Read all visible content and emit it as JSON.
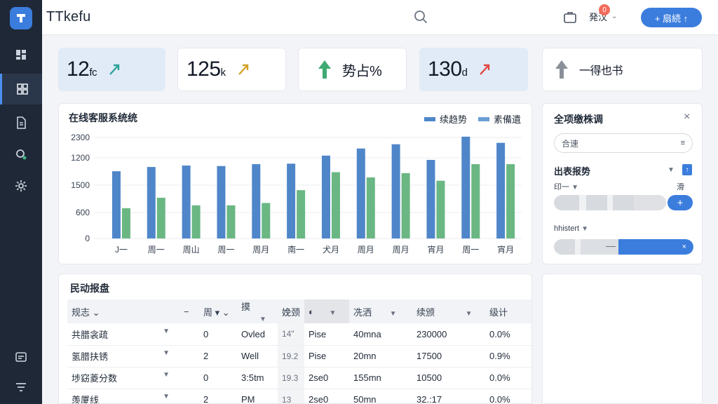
{
  "app": {
    "title": "TTkefu"
  },
  "header": {
    "user_label": "発汉",
    "badge": "0",
    "action_label": "+ 扇続 ↑"
  },
  "sidebar": {
    "items": [
      "dashboard",
      "grid",
      "docs",
      "search",
      "settings"
    ],
    "bottom": [
      "chat",
      "filter"
    ]
  },
  "stats": [
    {
      "value": "12",
      "suffix": "fc",
      "trend": "up"
    },
    {
      "value": "125",
      "suffix": "k",
      "trend": "up"
    },
    {
      "value": "",
      "label": "势占%",
      "trend": "up"
    },
    {
      "value": "130",
      "suffix": "d",
      "trend": "up"
    },
    {
      "value": "",
      "label": "一得也书",
      "trend": "up"
    }
  ],
  "chart_panel": {
    "title": "在线客服系统统",
    "legend": [
      "续趋势",
      "素備遺"
    ]
  },
  "chart_data": {
    "type": "bar",
    "categories": [
      "J一",
      "周一",
      "周山",
      "周一",
      "周月",
      "南一",
      "犬月",
      "周月",
      "周月",
      "宵月",
      "周一",
      "宵月"
    ],
    "yticks": [
      "2300",
      "1200",
      "1500",
      "600",
      "0"
    ],
    "series": [
      {
        "name": "续趋势",
        "color": "#4f86c9",
        "values": [
          1420,
          1510,
          1540,
          1530,
          1570,
          1580,
          1750,
          1900,
          1990,
          1660,
          2150,
          2020
        ]
      },
      {
        "name": "素備遺",
        "color": "#6ab784",
        "values": [
          640,
          860,
          700,
          700,
          750,
          1020,
          1400,
          1290,
          1380,
          1220,
          1570,
          1570
        ]
      }
    ],
    "ylim": [
      0,
      2400
    ]
  },
  "right_panel": {
    "title": "全项缴株调",
    "close": "×",
    "input_value": "合速",
    "section1_label": "出表报势",
    "section1_sub": "印一",
    "section1_sub_right": "滑",
    "section2_label": "hhistert",
    "plus": "+",
    "x": "×"
  },
  "table": {
    "title": "民动报盘",
    "headers": [
      "规志 ⌄",
      "",
      "周 ▾ ⌄",
      "摸",
      "",
      "娩颈",
      "",
      "冼洒",
      "",
      "续颁",
      "",
      "级计"
    ],
    "rows": [
      [
        "共腊衾疏",
        "0",
        "Ovled",
        "14\"",
        "Pise",
        "40mna",
        "230000",
        "0.0%"
      ],
      [
        "氢腊扶锈",
        "2",
        "Well",
        "19.2",
        "Pise",
        "20mn",
        "17500",
        "0.9%"
      ],
      [
        "埗窈菱分数",
        "0",
        "3:5tm",
        "19.3",
        "2se0",
        "155mn",
        "10500",
        "0.0%"
      ],
      [
        "羡厦线",
        "2",
        "PM",
        "13",
        "2se0",
        "50mn",
        "32.:17",
        "0.0%"
      ]
    ]
  },
  "colors": {
    "accent": "#3b7ddd",
    "sidebar": "#1f2837",
    "bar_blue": "#4f86c9",
    "bar_green": "#6ab784"
  }
}
